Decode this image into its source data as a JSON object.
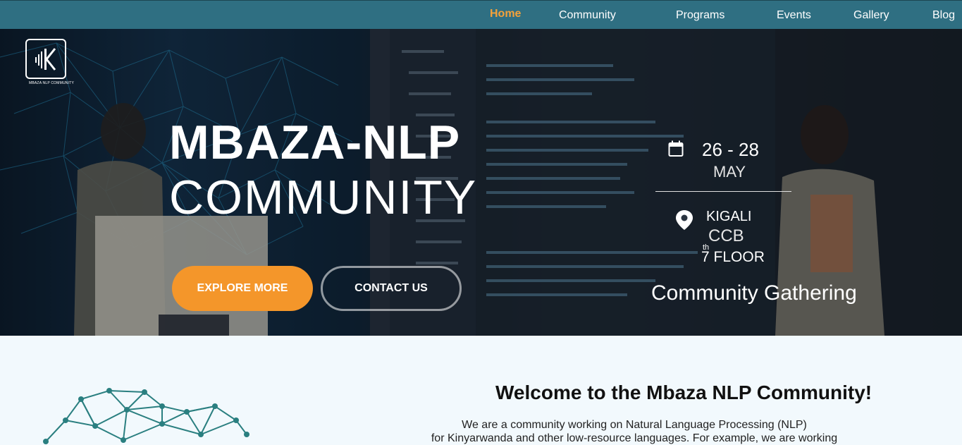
{
  "nav": {
    "items": [
      {
        "label": "Home",
        "active": true
      },
      {
        "label": "Community"
      },
      {
        "label": "Programs"
      },
      {
        "label": "Events"
      },
      {
        "label": "Gallery"
      },
      {
        "label": "Blog"
      }
    ]
  },
  "brand": {
    "logo_text": "MBAZA NLP COMMUNITY",
    "logo_icon": "soundwave-k-icon"
  },
  "hero": {
    "title_line1": "MBAZA-NLP",
    "title_line2": "COMMUNITY",
    "explore_label": "EXPLORE MORE",
    "contact_label": "CONTACT US"
  },
  "event": {
    "date": "26 - 28",
    "month": "MAY",
    "city": "KIGALI",
    "venue": "CCB",
    "floor": "7 FLOOR",
    "floor_super": "th",
    "name": "Community Gathering",
    "calendar_icon": "calendar-icon",
    "location_icon": "location-pin-icon"
  },
  "welcome": {
    "title": "Welcome to the Mbaza NLP Community!",
    "text_line1": "We are a community working on Natural Language Processing (NLP)",
    "text_line2": "for Kinyarwanda and other low-resource languages. For example, we are working"
  },
  "colors": {
    "nav_bg": "#2f6f82",
    "accent": "#f4962a",
    "active_nav": "#f4a23a",
    "network": "#2a7f80"
  }
}
